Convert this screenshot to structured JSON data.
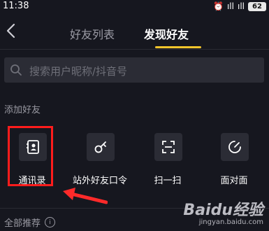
{
  "status_bar": {
    "time": "11:38",
    "signal": "ıll",
    "battery": "62"
  },
  "nav": {
    "tabs": [
      {
        "label": "好友列表",
        "active": false
      },
      {
        "label": "发现好友",
        "active": true
      }
    ]
  },
  "search": {
    "placeholder": "搜索用户昵称/抖音号"
  },
  "add_friends": {
    "title": "添加好友",
    "actions": [
      {
        "label": "通讯录",
        "icon": "contacts-icon"
      },
      {
        "label": "站外好友口令",
        "icon": "key-icon"
      },
      {
        "label": "扫一扫",
        "icon": "scan-icon"
      },
      {
        "label": "面对面",
        "icon": "face-to-face-icon"
      }
    ]
  },
  "recommend": {
    "title": "全部推荐"
  },
  "watermark": {
    "brand": "Baidu经验",
    "url": "jingyan.baidu.com"
  },
  "colors": {
    "accent": "#f5c52c",
    "highlight": "#ff1c1c",
    "background": "#16171f",
    "tile": "#2b2c35"
  }
}
